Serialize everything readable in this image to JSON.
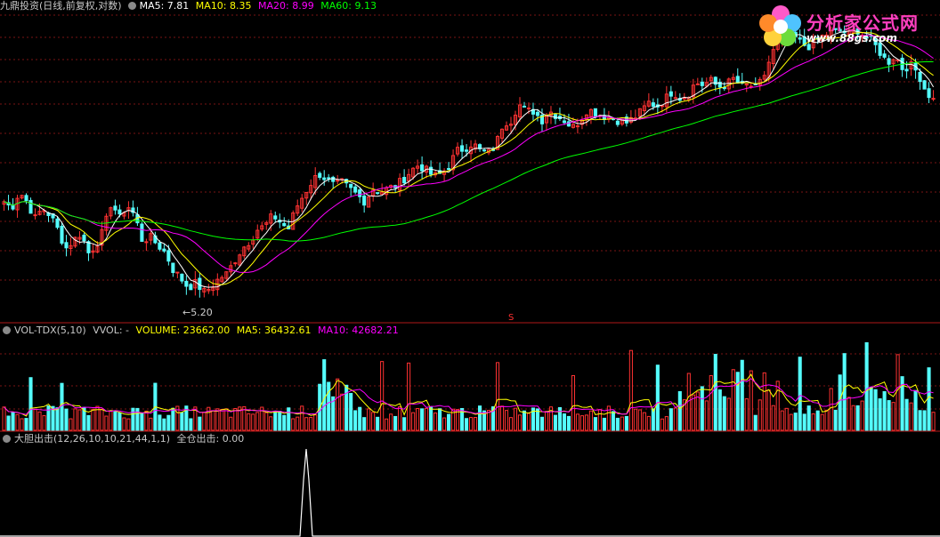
{
  "header_main": {
    "title": "九鼎投资(日线,前复权,对数)",
    "ma5": "MA5: 7.81",
    "ma10": "MA10: 8.35",
    "ma20": "MA20: 8.99",
    "ma60": "MA60: 9.13"
  },
  "header_vol": {
    "title": "VOL-TDX(5,10)",
    "vvol": "VVOL: -",
    "volume": "VOLUME: 23662.00",
    "ma5": "MA5: 36432.61",
    "ma10": "MA10: 42682.21"
  },
  "header_ind": {
    "title": "大胆出击(12,26,10,10,21,44,1,1)",
    "value": "全仓出击: 0.00"
  },
  "logo": {
    "name": "分析家公式网",
    "url": "www.88gs.com"
  },
  "colors": {
    "up": "#ff3232",
    "down": "#54fcfc",
    "ma5": "#ffffff",
    "ma10": "#ffff00",
    "ma20": "#ff00ff",
    "ma60": "#00ff00",
    "grid": "#7a1414"
  },
  "chart_data": {
    "type": "candlestick",
    "price_ylim": [
      5.0,
      15.8
    ],
    "volume_ylim": [
      0,
      100000
    ],
    "annotation_low": "5.20",
    "marker": "S",
    "candles_close": [
      7.6,
      7.4,
      7.9,
      7.6,
      7.1,
      7.4,
      7.2,
      6.8,
      6.3,
      6.5,
      6.7,
      6.2,
      6.4,
      6.8,
      7.6,
      7.1,
      7.5,
      7.2,
      6.5,
      6.6,
      6.4,
      6.2,
      5.8,
      5.6,
      5.4,
      5.5,
      5.3,
      5.4,
      5.6,
      5.7,
      6.0,
      6.3,
      6.5,
      6.8,
      6.9,
      7.2,
      7.0,
      6.8,
      7.4,
      7.8,
      8.2,
      8.5,
      8.3,
      8.1,
      8.2,
      8.0,
      7.8,
      7.6,
      8.0,
      7.9,
      8.0,
      8.1,
      8.3,
      8.6,
      8.8,
      8.6,
      8.4,
      8.5,
      8.8,
      9.3,
      9.4,
      9.6,
      9.3,
      9.2,
      9.5,
      10.4,
      10.5,
      11.2,
      10.9,
      10.9,
      10.5,
      10.9,
      10.7,
      10.5,
      10.2,
      10.5,
      11.0,
      10.8,
      10.7,
      10.6,
      10.5,
      10.4,
      10.6,
      10.9,
      11.3,
      11.1,
      11.4,
      11.8,
      11.5,
      11.6,
      12.2,
      12.1,
      12.3,
      12.0,
      12.1,
      12.4,
      12.0,
      12.1,
      11.9,
      12.6,
      13.7,
      14.5,
      14.9,
      14.6,
      14.2,
      14.1,
      14.5,
      14.8,
      14.9,
      15.0,
      14.8,
      15.1,
      14.7,
      14.4,
      13.8,
      13.2,
      13.6,
      12.9,
      13.1,
      12.7,
      11.8,
      11.4
    ],
    "volume_sample": [
      23662,
      36432.61,
      42682.21
    ],
    "indicator_value": 0.0
  }
}
